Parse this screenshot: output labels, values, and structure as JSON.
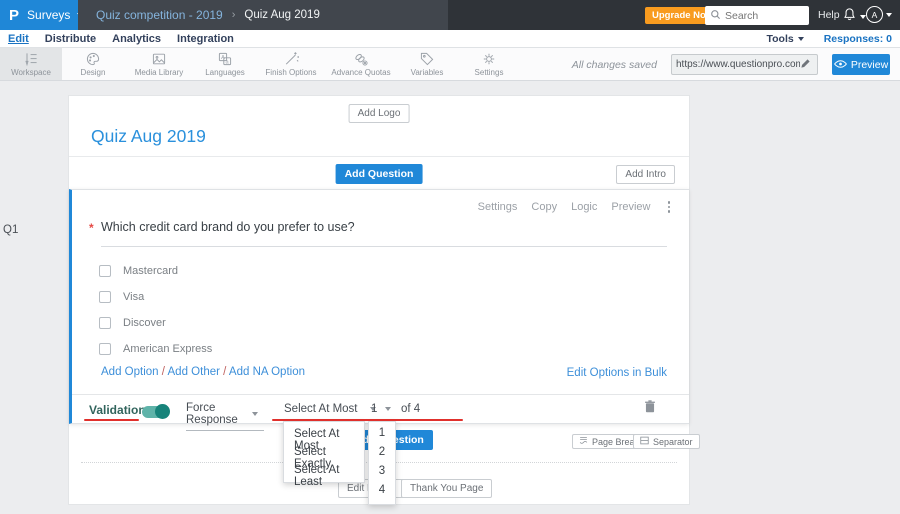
{
  "header": {
    "logo_letter": "P",
    "product_menu": "Surveys",
    "breadcrumb": {
      "parent": "Quiz competition - 2019",
      "separator": "›",
      "current": "Quiz Aug 2019"
    },
    "upgrade_button": "Upgrade Now",
    "search_placeholder": "Search",
    "help_label": "Help",
    "avatar_letter": "A"
  },
  "nav": {
    "items": [
      {
        "label": "Edit"
      },
      {
        "label": "Distribute"
      },
      {
        "label": "Analytics"
      },
      {
        "label": "Integration"
      }
    ],
    "tools_label": "Tools",
    "responses_label": "Responses: 0"
  },
  "toolbar": {
    "items": [
      {
        "label": "Workspace"
      },
      {
        "label": "Design"
      },
      {
        "label": "Media Library"
      },
      {
        "label": "Languages"
      },
      {
        "label": "Finish Options"
      },
      {
        "label": "Advance Quotas"
      },
      {
        "label": "Variables"
      },
      {
        "label": "Settings"
      }
    ],
    "autosave_status": "All changes saved",
    "survey_url": "https://www.questionpro.com/t/APNrFZ",
    "preview_label": "Preview"
  },
  "survey": {
    "add_logo_label": "Add Logo",
    "title": "Quiz Aug 2019",
    "add_question_label": "Add Question",
    "add_question_bottom_label": "Add Question",
    "add_intro_label": "Add Intro",
    "question": {
      "id_label": "Q1",
      "actions": [
        {
          "label": "Settings"
        },
        {
          "label": "Copy"
        },
        {
          "label": "Logic"
        },
        {
          "label": "Preview"
        }
      ],
      "required_marker": "*",
      "text": "Which credit card brand do you prefer to use?",
      "options": [
        {
          "label": "Mastercard"
        },
        {
          "label": "Visa"
        },
        {
          "label": "Discover"
        },
        {
          "label": "American Express"
        }
      ],
      "add_option_links": {
        "option": "Add Option",
        "other": "Add Other",
        "na": "Add NA Option",
        "separator": "/"
      },
      "edit_bulk_label": "Edit Options in Bulk",
      "validation": {
        "label": "Validation",
        "force_response_label": "Force Response",
        "rule_selected": "Select At Most",
        "count_selected": "1",
        "of_label": "of 4"
      }
    },
    "page_break_label": "Page Break",
    "separator_label": "Separator",
    "edit_footer_label": "Edit Footer",
    "thank_you_label": "Thank You Page"
  },
  "dropdowns": {
    "rule_options": [
      "Select At Most",
      "Select Exactly",
      "Select At Least"
    ],
    "count_options": [
      "1",
      "2",
      "3",
      "4"
    ]
  },
  "colors": {
    "accent_blue": "#2088d8",
    "header_dark": "#2f3338",
    "breadcrumb_panel": "#41464d",
    "upgrade_orange": "#f89b1f",
    "annotation_red": "#e0302c",
    "toggle_teal": "#5fb3a9",
    "toggle_knob_teal": "#17837a"
  }
}
